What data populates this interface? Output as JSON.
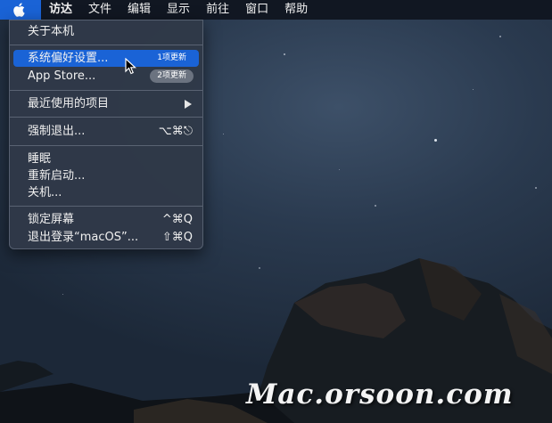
{
  "menubar": {
    "apple_icon": "apple-logo-icon",
    "items": [
      "访达",
      "文件",
      "编辑",
      "显示",
      "前往",
      "窗口",
      "帮助"
    ]
  },
  "apple_menu": {
    "about": "关于本机",
    "system_prefs": "系统偏好设置...",
    "system_prefs_badge": "1项更新",
    "app_store": "App Store...",
    "app_store_badge": "2项更新",
    "recent_items": "最近使用的项目",
    "force_quit": "强制退出...",
    "force_quit_shortcut": "⌥⌘⎋",
    "sleep": "睡眠",
    "restart": "重新启动...",
    "shutdown": "关机...",
    "lock_screen": "锁定屏幕",
    "lock_screen_shortcut": "^⌘Q",
    "logout": "退出登录“macOS”...",
    "logout_shortcut": "⇧⌘Q"
  },
  "watermark": "Mac.orsoon.com",
  "colors": {
    "highlight": "#1a63d6",
    "menu_bg": "#2f3948",
    "menubar_bg": "#111722"
  }
}
